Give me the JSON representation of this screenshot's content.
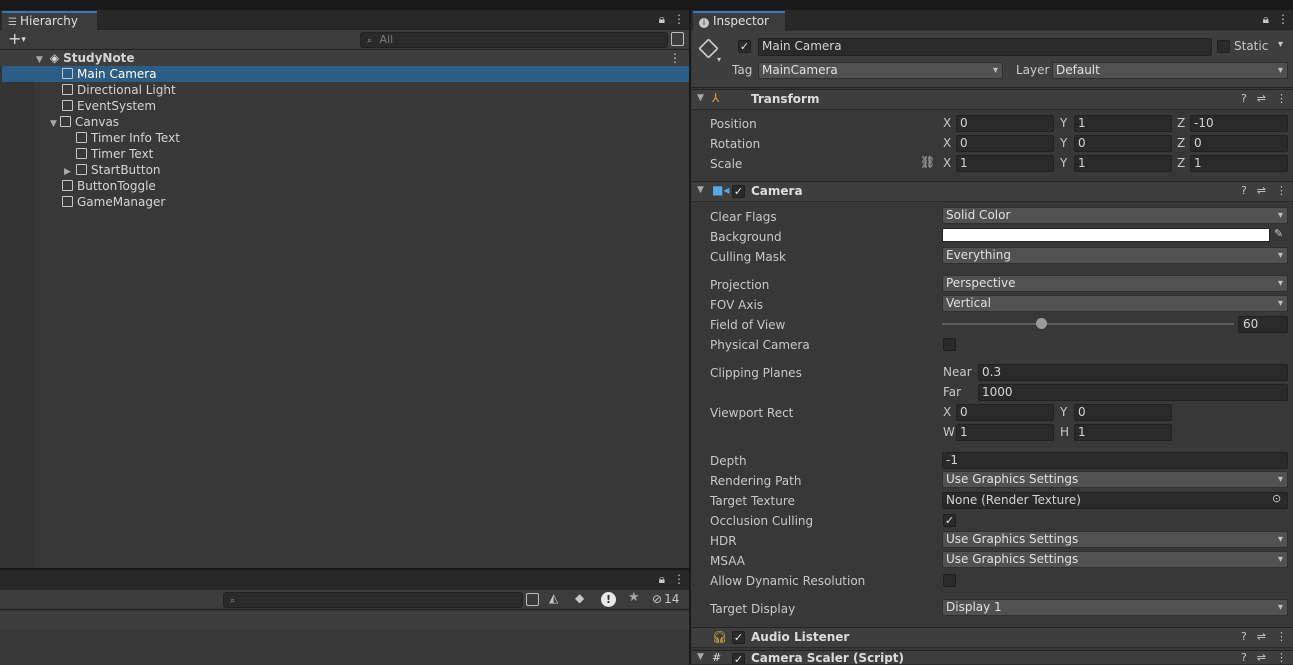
{
  "hierarchy": {
    "tab_label": "Hierarchy",
    "search_placeholder": "All",
    "scene": "StudyNote",
    "items": [
      {
        "label": "Main Camera",
        "selected": true
      },
      {
        "label": "Directional Light"
      },
      {
        "label": "EventSystem"
      },
      {
        "label": "Canvas"
      },
      {
        "label": "Timer Info Text"
      },
      {
        "label": "Timer Text"
      },
      {
        "label": "StartButton"
      },
      {
        "label": "ButtonToggle"
      },
      {
        "label": "GameManager"
      }
    ]
  },
  "console": {
    "hidden_count": "14"
  },
  "inspector": {
    "tab_label": "Inspector",
    "object_name": "Main Camera",
    "static_label": "Static",
    "tag_label": "Tag",
    "tag_value": "MainCamera",
    "layer_label": "Layer",
    "layer_value": "Default",
    "transform": {
      "title": "Transform",
      "position_label": "Position",
      "rotation_label": "Rotation",
      "scale_label": "Scale",
      "x_label": "X",
      "y_label": "Y",
      "z_label": "Z",
      "position": {
        "x": "0",
        "y": "1",
        "z": "-10"
      },
      "rotation": {
        "x": "0",
        "y": "0",
        "z": "0"
      },
      "scale": {
        "x": "1",
        "y": "1",
        "z": "1"
      }
    },
    "camera": {
      "title": "Camera",
      "clear_flags_label": "Clear Flags",
      "clear_flags_value": "Solid Color",
      "background_label": "Background",
      "background_color": "#ffffff",
      "culling_mask_label": "Culling Mask",
      "culling_mask_value": "Everything",
      "projection_label": "Projection",
      "projection_value": "Perspective",
      "fov_axis_label": "FOV Axis",
      "fov_axis_value": "Vertical",
      "fov_label": "Field of View",
      "fov_value": "60",
      "fov_slider_fraction": 0.34,
      "physical_camera_label": "Physical Camera",
      "clipping_planes_label": "Clipping Planes",
      "near_label": "Near",
      "near_value": "0.3",
      "far_label": "Far",
      "far_value": "1000",
      "viewport_rect_label": "Viewport Rect",
      "w_label": "W",
      "h_label": "H",
      "viewport": {
        "x": "0",
        "y": "0",
        "w": "1",
        "h": "1"
      },
      "depth_label": "Depth",
      "depth_value": "-1",
      "rendering_path_label": "Rendering Path",
      "rendering_path_value": "Use Graphics Settings",
      "target_texture_label": "Target Texture",
      "target_texture_value": "None (Render Texture)",
      "occlusion_culling_label": "Occlusion Culling",
      "hdr_label": "HDR",
      "hdr_value": "Use Graphics Settings",
      "msaa_label": "MSAA",
      "msaa_value": "Use Graphics Settings",
      "dynamic_resolution_label": "Allow Dynamic Resolution",
      "target_display_label": "Target Display",
      "target_display_value": "Display 1"
    },
    "audio_listener_title": "Audio Listener",
    "camera_scaler_title": "Camera Scaler (Script)"
  },
  "colors": {
    "selection": "#2c5d87",
    "accent": "#3a79bb"
  }
}
